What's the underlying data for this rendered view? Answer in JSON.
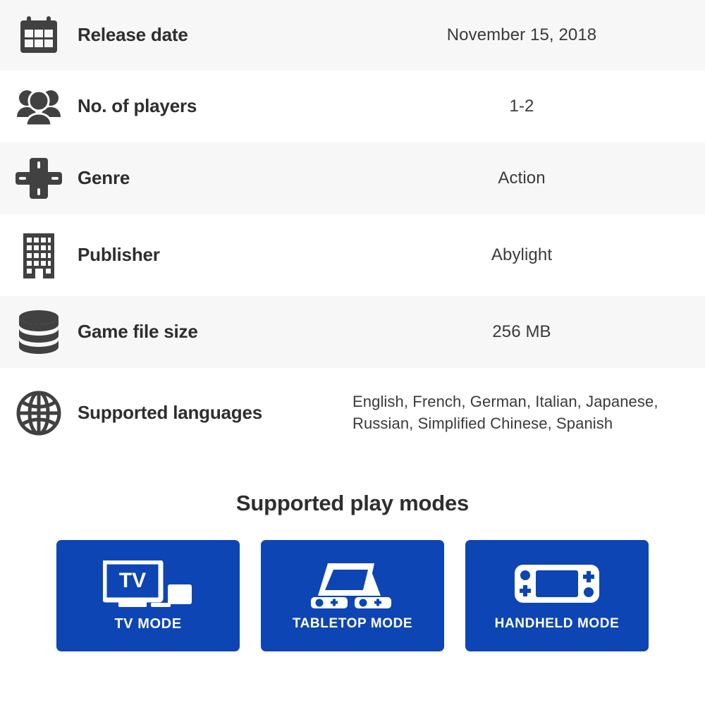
{
  "colors": {
    "row_alt_bg": "#f7f7f7",
    "row_bg": "#ffffff",
    "label_text": "#2e2e2e",
    "value_text": "#3a3a3a",
    "icon": "#414141",
    "card_blue": "#0d45b5",
    "card_text": "#ffffff"
  },
  "spec_rows": [
    {
      "icon": "calendar-icon",
      "label": "Release date",
      "value": "November 15, 2018"
    },
    {
      "icon": "players-icon",
      "label": "No. of players",
      "value": "1-2"
    },
    {
      "icon": "dpad-icon",
      "label": "Genre",
      "value": "Action"
    },
    {
      "icon": "building-icon",
      "label": "Publisher",
      "value": "Abylight"
    },
    {
      "icon": "database-icon",
      "label": "Game file size",
      "value": "256 MB"
    },
    {
      "icon": "globe-icon",
      "label": "Supported languages",
      "value": "English, French, German, Italian, Japanese, Russian, Simplified Chinese, Spanish"
    }
  ],
  "play_modes": {
    "title": "Supported play modes",
    "cards": [
      {
        "icon": "tv-mode-icon",
        "label": "TV MODE",
        "screen_text": "TV"
      },
      {
        "icon": "tabletop-mode-icon",
        "label": "TABLETOP MODE"
      },
      {
        "icon": "handheld-mode-icon",
        "label": "HANDHELD MODE"
      }
    ]
  }
}
